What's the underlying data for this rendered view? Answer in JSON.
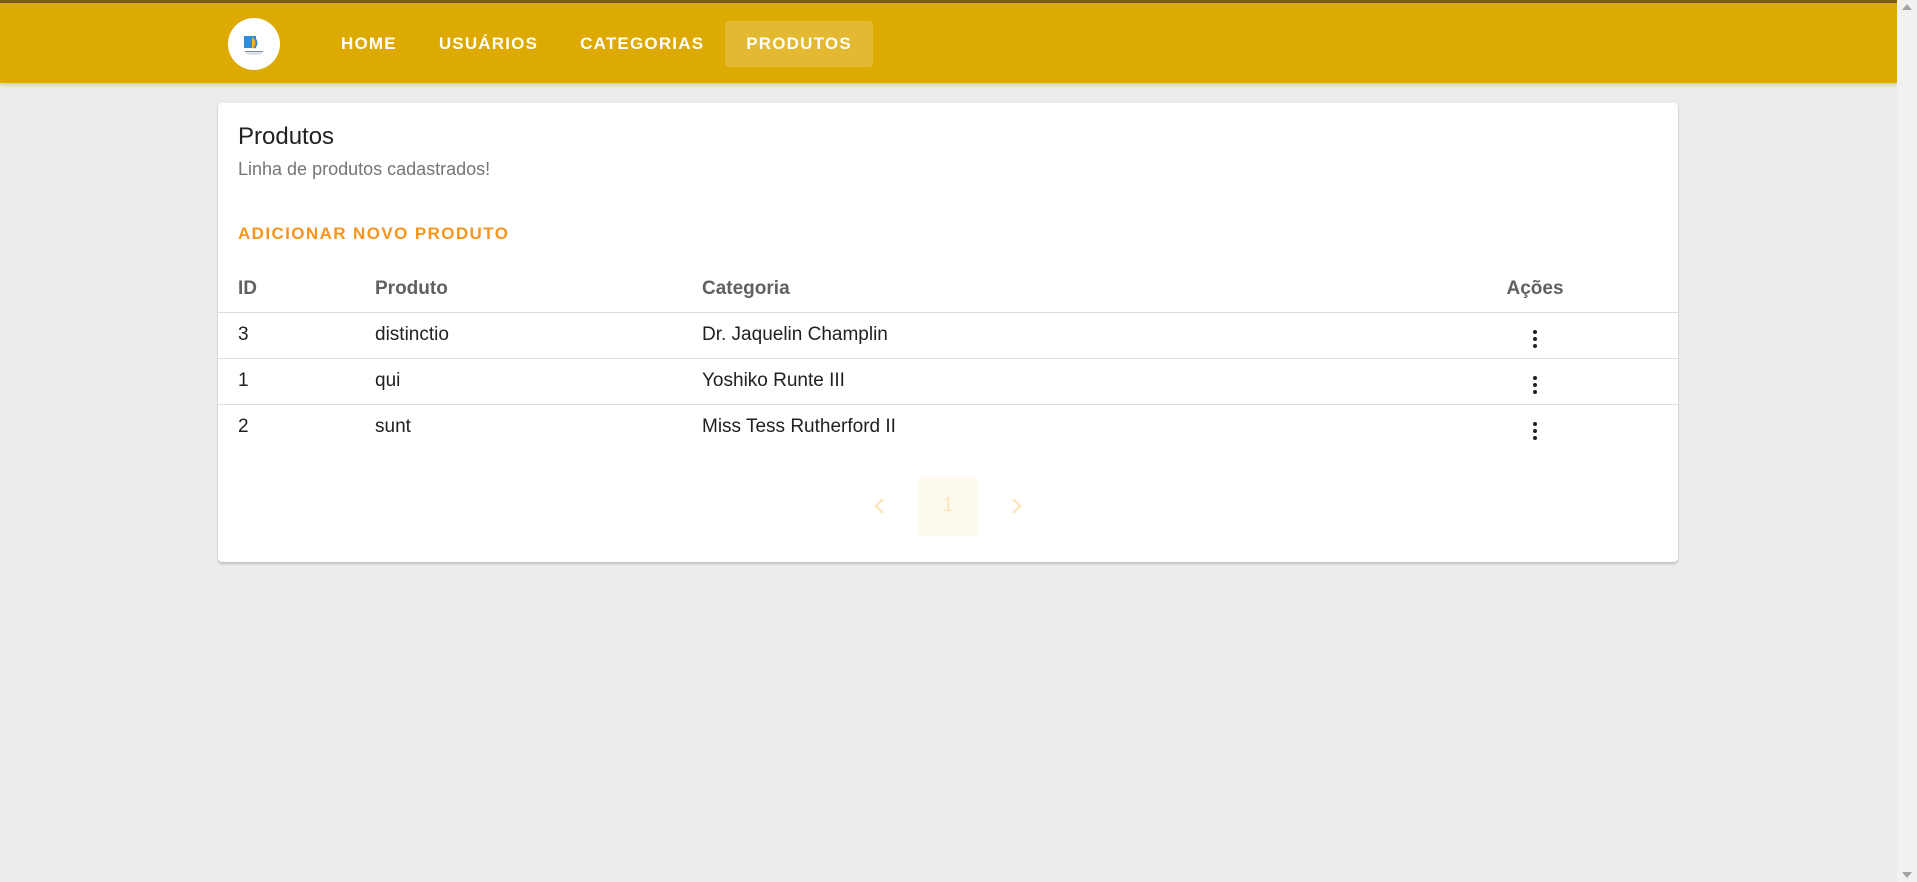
{
  "nav": {
    "logo_alt": "logo-icon",
    "items": [
      {
        "label": "HOME",
        "active": false
      },
      {
        "label": "USUÁRIOS",
        "active": false
      },
      {
        "label": "CATEGORIAS",
        "active": false
      },
      {
        "label": "PRODUTOS",
        "active": true
      }
    ]
  },
  "card": {
    "title": "Produtos",
    "subtitle": "Linha de produtos cadastrados!",
    "add_button": "ADICIONAR NOVO PRODUTO"
  },
  "table": {
    "headers": {
      "id": "ID",
      "produto": "Produto",
      "categoria": "Categoria",
      "acoes": "Ações"
    },
    "rows": [
      {
        "id": "3",
        "produto": "distinctio",
        "categoria": "Dr. Jaquelin Champlin"
      },
      {
        "id": "1",
        "produto": "qui",
        "categoria": "Yoshiko Runte III"
      },
      {
        "id": "2",
        "produto": "sunt",
        "categoria": "Miss Tess Rutherford II"
      }
    ]
  },
  "pagination": {
    "current_page": "1",
    "prev_icon": "chevron-left-icon",
    "next_icon": "chevron-right-icon"
  },
  "colors": {
    "appbar": "#dcaa03",
    "accent": "#f7941d",
    "background": "#ececec"
  }
}
